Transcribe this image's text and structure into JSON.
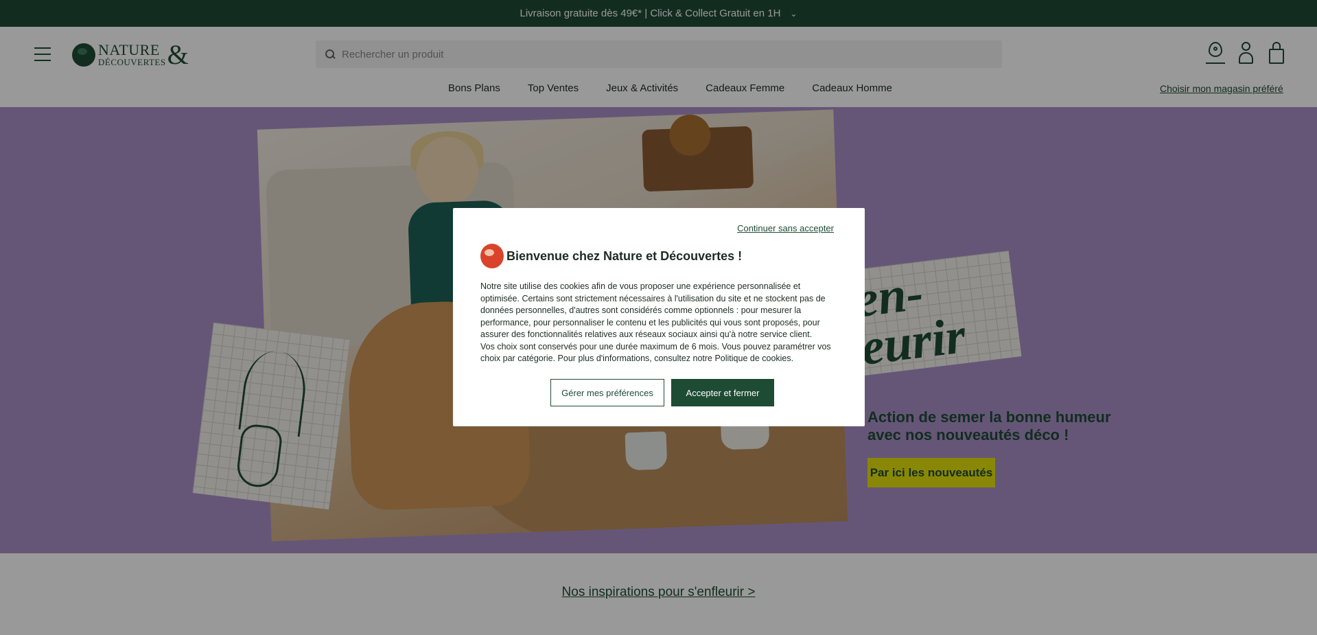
{
  "topbar": {
    "text": "Livraison gratuite dès 49€* | Click & Collect Gratuit en 1H",
    "chevron": "⌄"
  },
  "header": {
    "logo": {
      "line1": "NATURE",
      "line2": "DÉCOUVERTES",
      "amp": "&"
    },
    "search": {
      "placeholder": "Rechercher un produit"
    },
    "nav": [
      "Bons Plans",
      "Top Ventes",
      "Jeux & Activités",
      "Cadeaux Femme",
      "Cadeaux Homme"
    ],
    "store_link": "Choisir mon magasin préféré",
    "icons": [
      "menu-icon",
      "search-icon",
      "store-locator-icon",
      "account-icon",
      "cart-icon"
    ]
  },
  "hero": {
    "card_text": "en-\neurir",
    "text": "Action de semer la bonne humeur avec nos nouveautés déco !",
    "cta": "Par ici les nouveautés"
  },
  "inspirations_link": "Nos inspirations pour s'enfleurir >",
  "cookie_modal": {
    "continue_link": "Continuer sans accepter",
    "title": "Bienvenue chez Nature et Découvertes !",
    "body_p1": "Notre site utilise des cookies afin de vous proposer une expérience personnalisée et optimisée. Certains sont strictement nécessaires à l'utilisation du site et ne stockent pas de données personnelles, d'autres sont considérés comme optionnels : pour mesurer la performance, pour personnaliser le contenu et les publicités qui vous sont proposés, pour assurer des fonctionnalités relatives aux réseaux sociaux ainsi qu'à notre service client.",
    "body_p2": "Vos choix sont conservés pour une durée maximum de 6 mois. Vous pouvez paramétrer vos choix par catégorie. Pour plus d'informations, consultez notre Politique de cookies.",
    "btn_preferences": "Gérer mes préférences",
    "btn_accept": "Accepter et fermer"
  },
  "colors": {
    "brand_green": "#1e4b34",
    "hero_bg": "#a98fc8",
    "cta_yellow": "#e5e10a",
    "logo_globe_modal": "#d9432b"
  }
}
